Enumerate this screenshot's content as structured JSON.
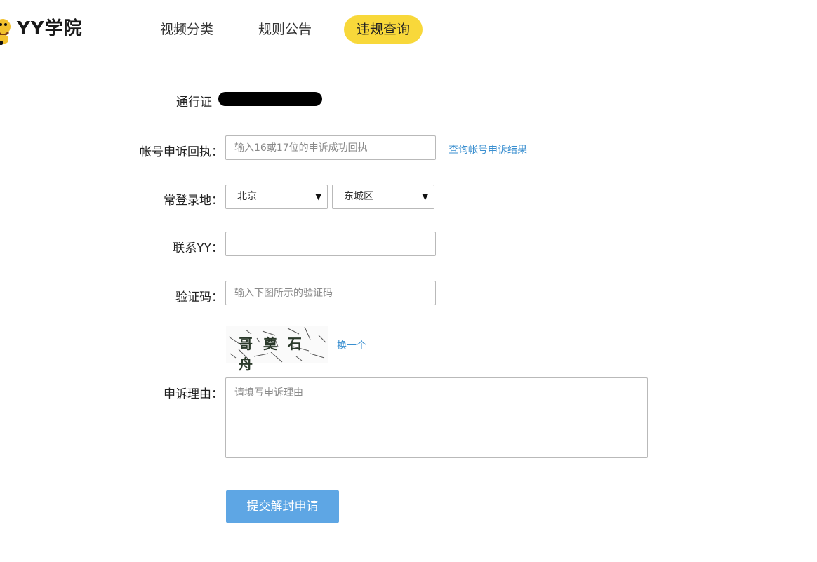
{
  "header": {
    "logo_text": "YY学院",
    "nav": [
      {
        "label": "视频分类"
      },
      {
        "label": "规则公告"
      },
      {
        "label": "违规查询",
        "active": true
      }
    ],
    "accent_color": "#f8d83a"
  },
  "form": {
    "passport_label": "通行证",
    "receipt_label": "帐号申诉回执：",
    "receipt_placeholder": "输入16或17位的申诉成功回执",
    "receipt_link": "查询帐号申诉结果",
    "location_label": "常登录地：",
    "province_value": "北京",
    "district_value": "东城区",
    "contact_label": "联系YY：",
    "contact_value": "",
    "captcha_label": "验证码：",
    "captcha_placeholder": "输入下图所示的验证码",
    "captcha_text": "哥 奠 石 舟",
    "captcha_refresh": "换一个",
    "reason_label": "申诉理由：",
    "reason_placeholder": "请填写申诉理由",
    "submit_label": "提交解封申请"
  },
  "colors": {
    "link": "#3a8fd0",
    "submit": "#5ea6e4"
  }
}
